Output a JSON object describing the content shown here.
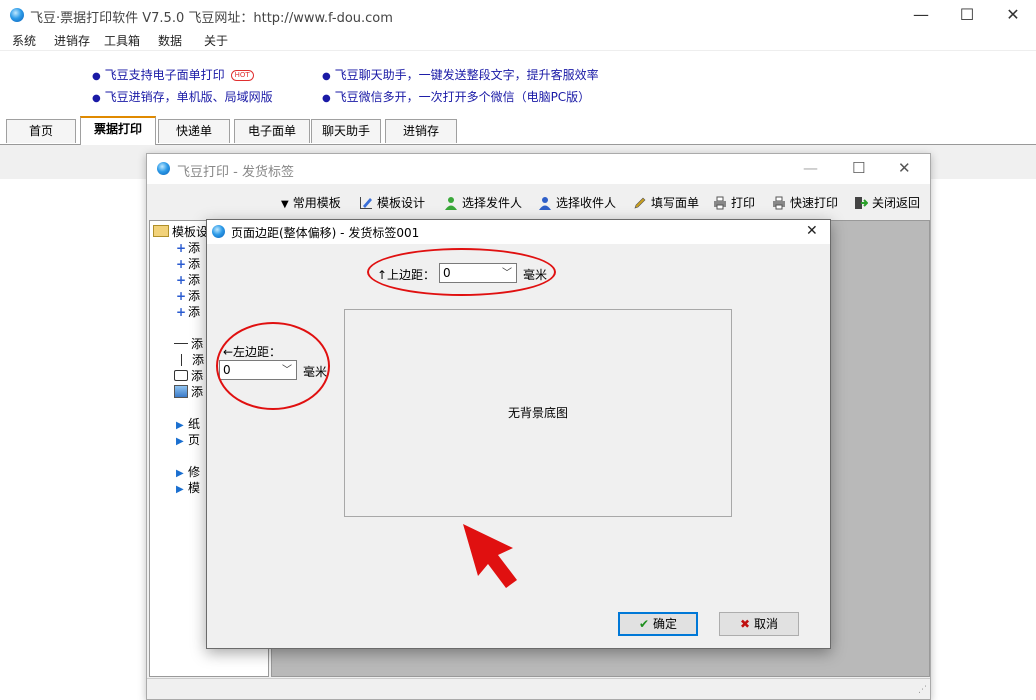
{
  "main_window": {
    "title": "飞豆·票据打印软件 V7.5.0   飞豆网址：http://www.f-dou.com",
    "controls": {
      "minimize": "—",
      "maximize": "☐",
      "close": "✕"
    }
  },
  "menu": [
    "系统",
    "进销存",
    "工具箱",
    "数据",
    "关于"
  ],
  "links": [
    {
      "text": "飞豆支持电子面单打印",
      "badge": "HOT"
    },
    {
      "text": "飞豆进销存，单机版、局域网版"
    },
    {
      "text": "飞豆聊天助手，一键发送整段文字，提升客服效率"
    },
    {
      "text": "飞豆微信多开，一次打开多个微信（电脑PC版）"
    }
  ],
  "tabs": [
    {
      "label": "首页",
      "active": false
    },
    {
      "label": "票据打印",
      "active": true
    },
    {
      "label": "快递单",
      "active": false
    },
    {
      "label": "电子面单",
      "active": false
    },
    {
      "label": "聊天助手",
      "active": false
    },
    {
      "label": "进销存",
      "active": false
    }
  ],
  "inner_window": {
    "title": "飞豆打印 - 发货标签",
    "controls": {
      "minimize": "—",
      "maximize": "☐",
      "close": "✕"
    },
    "toolbar": [
      {
        "label": "常用模板",
        "icon": "dropdown-arrow-icon"
      },
      {
        "label": "模板设计",
        "icon": "design-icon"
      },
      {
        "label": "选择发件人",
        "icon": "person-green-icon"
      },
      {
        "label": "选择收件人",
        "icon": "person-blue-icon"
      },
      {
        "label": "填写面单",
        "icon": "pencil-icon"
      },
      {
        "label": "打印",
        "icon": "printer-icon"
      },
      {
        "label": "快速打印",
        "icon": "printer-fast-icon"
      },
      {
        "label": "关闭返回",
        "icon": "exit-icon"
      }
    ],
    "tree": {
      "root": "模板设",
      "add_items": [
        "添",
        "添",
        "添",
        "添",
        "添"
      ],
      "shape_items": [
        {
          "label": "添",
          "icon": "line-icon"
        },
        {
          "label": "添",
          "icon": "vertical-line-icon"
        },
        {
          "label": "添",
          "icon": "rectangle-icon"
        },
        {
          "label": "添",
          "icon": "image-icon"
        }
      ],
      "group_a": [
        "纸",
        "页"
      ],
      "group_b": [
        "修",
        "模"
      ]
    }
  },
  "dialog": {
    "title": "页面边距(整体偏移) - 发货标签001",
    "close": "✕",
    "top_margin": {
      "label": "↑上边距：",
      "value": "0",
      "unit": "毫米"
    },
    "left_margin": {
      "label": "←左边距：",
      "value": "0",
      "unit": "毫米"
    },
    "preview_text": "无背景底图",
    "ok_label": "确定",
    "cancel_label": "取消"
  },
  "colors": {
    "annotation": "#e01010",
    "link": "#1a1aa6",
    "active_tab_accent": "#e08a00"
  }
}
